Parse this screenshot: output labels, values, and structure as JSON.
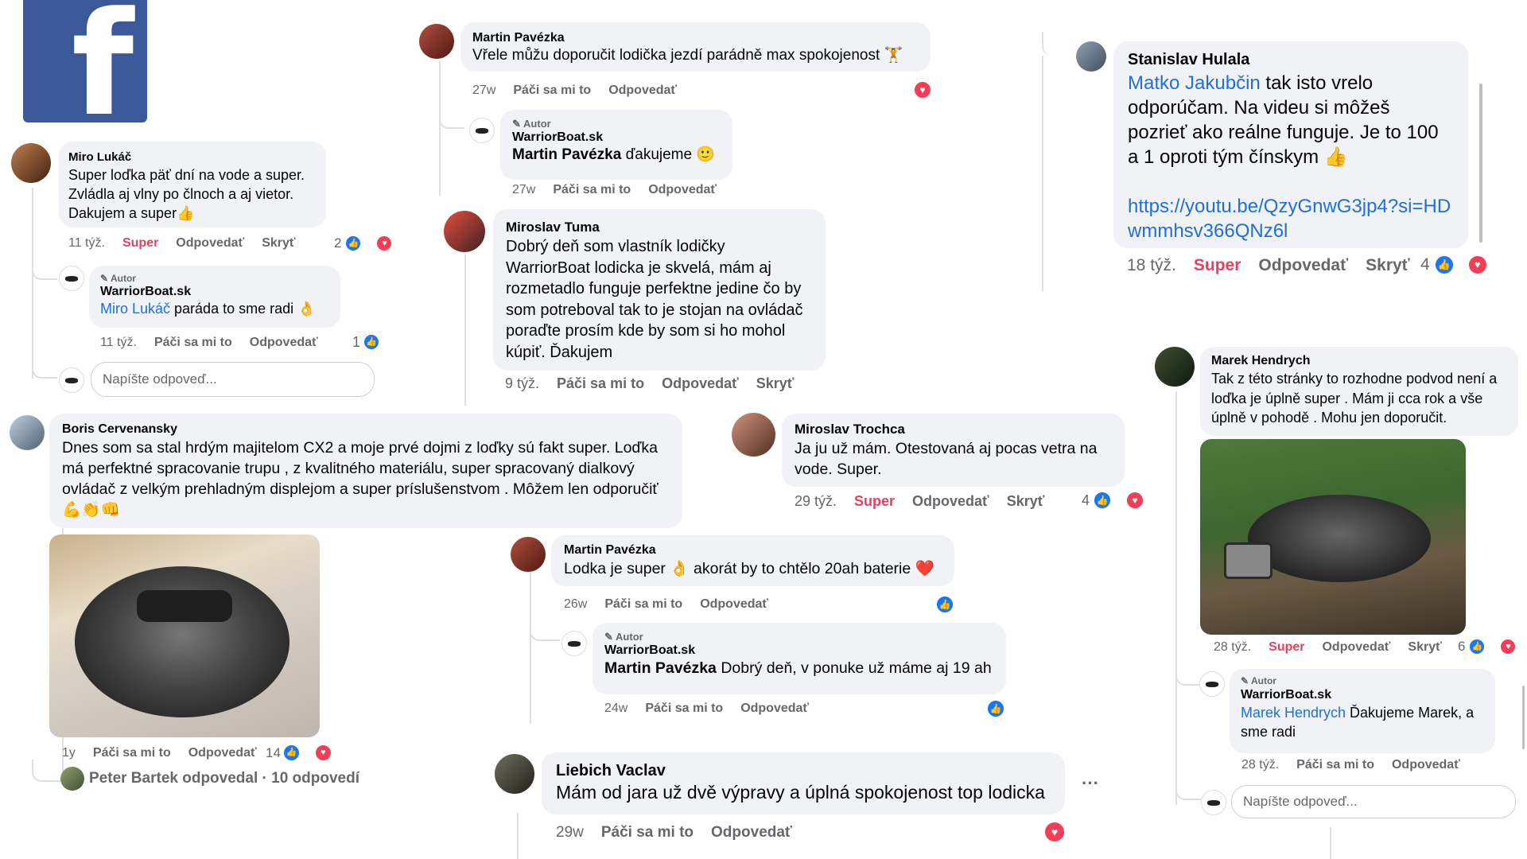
{
  "logo": {
    "letter": "f",
    "name": "Facebook"
  },
  "c1": {
    "name": "Miro Lukáč",
    "text": "Super loďka päť dní na vode a super. Zvládla aj vlny po člnoch a aj vietor. Dakujem a super👍",
    "time": "11 týž.",
    "reaction": "Super",
    "reply": "Odpovedať",
    "hide": "Skryť",
    "count": "2"
  },
  "r1": {
    "badge": "Autor",
    "name": "WarriorBoat.sk",
    "mention": "Miro Lukáč",
    "text": " paráda to sme radi 👌",
    "time": "11 týž.",
    "like": "Páči sa mi to",
    "reply": "Odpovedať",
    "count": "1"
  },
  "input1": {
    "placeholder": "Napíšte odpoveď..."
  },
  "c2": {
    "name": "Martin Pavézka",
    "text": "Vřele můžu doporučit lodička jezdí parádně max spokojenost 🏋",
    "time": "27w",
    "like": "Páči sa mi to",
    "reply": "Odpovedať"
  },
  "r2": {
    "badge": "Autor",
    "name": "WarriorBoat.sk",
    "mention": "Martin Pavézka",
    "text": " ďakujeme 🙂",
    "time": "27w",
    "like": "Páči sa mi to",
    "reply": "Odpovedať"
  },
  "c3": {
    "name": "Miroslav Tuma",
    "text": "Dobrý deň som vlastník lodičky WarriorBoat lodicka je skvelá, mám aj rozmetadlo funguje perfektne jedine čo by som potreboval tak to je stojan na ovládač poraďte prosím kde by som si ho mohol kúpiť. Ďakujem",
    "time": "9 týž.",
    "like": "Páči sa mi to",
    "reply": "Odpovedať",
    "hide": "Skryť"
  },
  "c4": {
    "name": "Stanislav Hulala",
    "mention": "Matko Jakubčin",
    "text": " tak isto vrelo odporúčam. Na videu si môžeš pozrieť ako reálne funguje. Je to 100 a 1 oproti tým čínskym 👍",
    "url": "https://youtu.be/QzyGnwG3jp4?si=HDwmmhsv366QNz6l",
    "time": "18 týž.",
    "reaction": "Super",
    "reply": "Odpovedať",
    "hide": "Skryť",
    "count": "4"
  },
  "c5": {
    "name": "Boris Cervenansky",
    "text": "Dnes som sa stal hrdým majitelom CX2 a moje prvé dojmi z loďky sú fakt super. Loďka má perfektné spracovanie trupu , z kvalitného materiálu, super spracovaný dialkový ovládač z velkým prehladným displejom a super príslušenstvom . Môžem len odporučiť 💪👏👊",
    "time": "1y",
    "like": "Páči sa mi to",
    "reply": "Odpovedať",
    "count": "14",
    "replies": "Peter Bartek odpovedal · 10 odpovedí"
  },
  "c6": {
    "name": "Miroslav Trochca",
    "text": "Ja ju už mám. Otestovaná aj pocas vetra na vode. Super.",
    "time": "29 týž.",
    "reaction": "Super",
    "reply": "Odpovedať",
    "hide": "Skryť",
    "count": "4"
  },
  "c7": {
    "name": "Martin Pavézka",
    "text": "Lodka je super 👌 akorát by to chtělo 20ah baterie ❤️",
    "time": "26w",
    "like": "Páči sa mi to",
    "reply": "Odpovedať"
  },
  "r7": {
    "badge": "Autor",
    "name": "WarriorBoat.sk",
    "mention": "Martin Pavézka",
    "text": " Dobrý deň, v ponuke už máme aj 19 ah",
    "time": "24w",
    "like": "Páči sa mi to",
    "reply": "Odpovedať"
  },
  "c8": {
    "name": "Liebich Vaclav",
    "text": "Mám od jara už dvě výpravy a úplná spokojenost top lodicka",
    "time": "29w",
    "like": "Páči sa mi to",
    "reply": "Odpovedať",
    "more": "···"
  },
  "c9": {
    "name": "Marek Hendrych",
    "text": "Tak z této stránky to rozhodne podvod není a loďka je úplně super . Mám ji cca rok a vše úplně v pohodě . Mohu jen doporučit.",
    "time": "28 týž.",
    "reaction": "Super",
    "reply": "Odpovedať",
    "hide": "Skryť",
    "count": "6"
  },
  "r9": {
    "badge": "Autor",
    "name": "WarriorBoat.sk",
    "mention": "Marek Hendrych",
    "text": " Ďakujeme Marek, a sme radi",
    "time": "28 týž.",
    "like": "Páči sa mi to",
    "reply": "Odpovedať"
  },
  "input2": {
    "placeholder": "Napíšte odpoveď..."
  },
  "colors": {
    "link": "#216fdb",
    "super": "#e4405f",
    "like": "#1877f2",
    "love": "#f33e58",
    "facebook": "#3b5998"
  }
}
